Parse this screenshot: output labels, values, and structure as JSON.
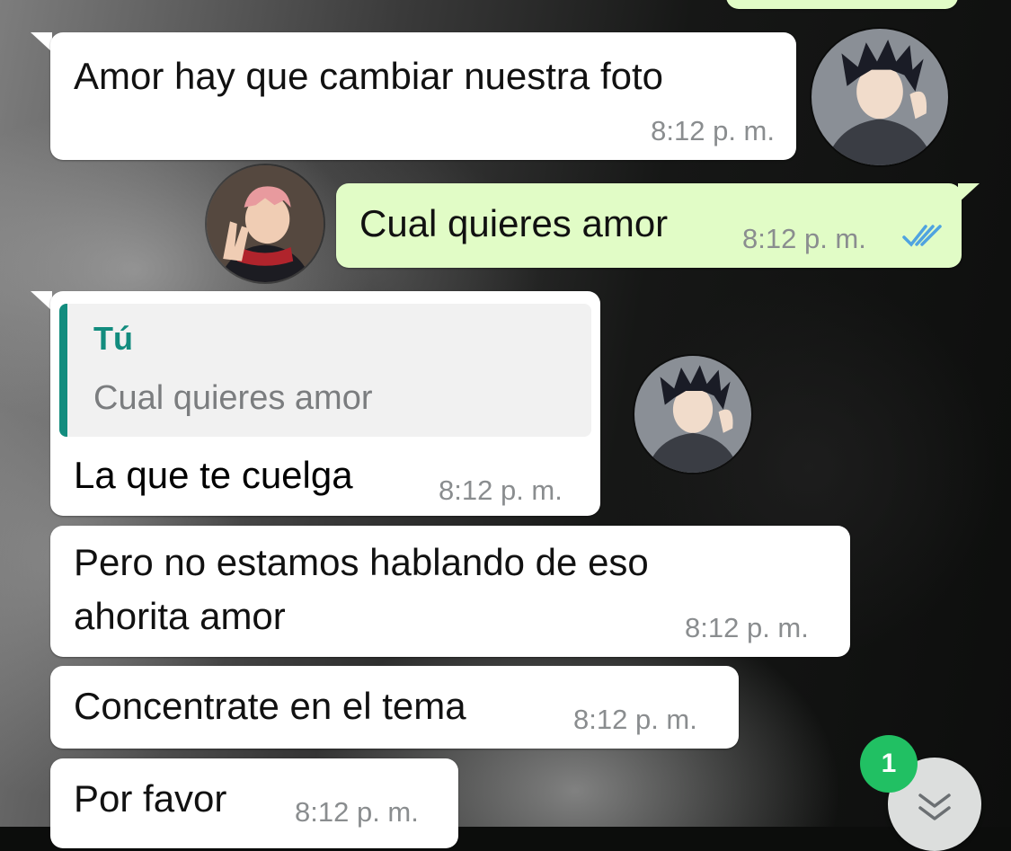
{
  "messages": [
    {
      "text": "Amor hay que cambiar nuestra foto",
      "time": "8:12 p. m."
    },
    {
      "text": "Cual quieres amor",
      "time": "8:12 p. m.",
      "status": "read-double-check"
    },
    {
      "reply_to": {
        "author": "Tú",
        "text": "Cual quieres amor"
      },
      "text": "La que te cuelga",
      "time": "8:12 p. m."
    },
    {
      "text_line1": "Pero no estamos hablando de eso",
      "text_line2": "ahorita amor",
      "time": "8:12 p. m."
    },
    {
      "text": "Concentrate en el tema",
      "time": "8:12 p. m."
    },
    {
      "text": "Por favor",
      "time": "8:12 p. m."
    }
  ],
  "scroll_down": {
    "unread_count": "1",
    "icon": "double-chevron-down-icon"
  },
  "colors": {
    "incoming_bubble": "#ffffff",
    "outgoing_bubble": "#e1fcc6",
    "reply_accent": "#128c7e",
    "read_ticks": "#4fa3e0",
    "badge": "#21c063"
  }
}
